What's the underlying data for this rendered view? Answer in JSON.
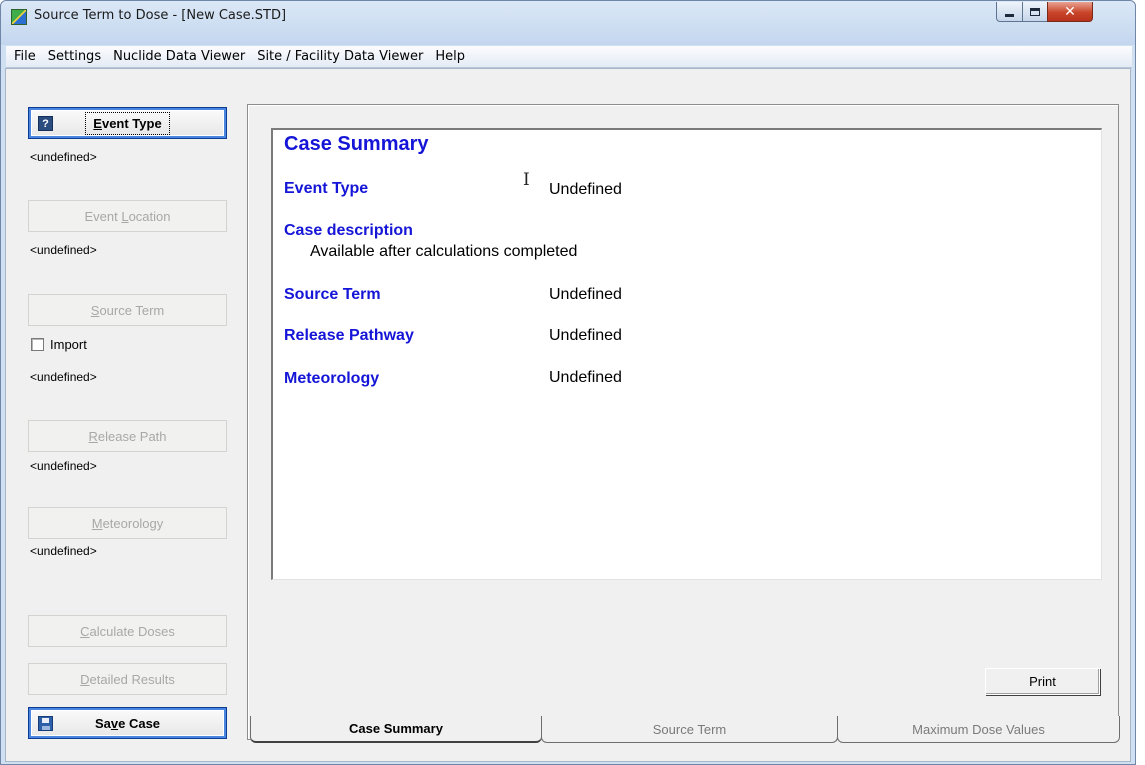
{
  "window": {
    "title": "Source Term to Dose - [New Case.STD]",
    "app_icon": "app-icon",
    "controls": [
      "minimize-icon",
      "maximize-icon",
      "close-icon"
    ]
  },
  "menu": {
    "items": [
      "File",
      "Settings",
      "Nuclide Data Viewer",
      "Site / Facility Data Viewer",
      "Help"
    ]
  },
  "sidebar": {
    "event_type": {
      "label": "Event Type",
      "accel": "E",
      "rest": "vent Type",
      "value": "<undefined>",
      "icon": "help-icon"
    },
    "event_location": {
      "pre": "Event ",
      "accel": "L",
      "rest": "ocation",
      "value": "<undefined>"
    },
    "source_term": {
      "pre": "",
      "accel": "S",
      "rest": "ource Term",
      "import_label": "Import",
      "import_checked": false,
      "value": "<undefined>"
    },
    "release_path": {
      "pre": "",
      "accel": "R",
      "rest": "elease Path",
      "value": "<undefined>"
    },
    "meteorology": {
      "pre": "",
      "accel": "M",
      "rest": "eteorology",
      "value": "<undefined>"
    },
    "calculate_doses": {
      "pre": "",
      "accel": "C",
      "rest": "alculate Doses"
    },
    "detailed_results": {
      "pre": "",
      "accel": "D",
      "rest": "etailed Results"
    },
    "save_case": {
      "pre": "Sa",
      "accel": "v",
      "rest": "e Case",
      "icon": "floppy-disk-icon"
    }
  },
  "summary": {
    "title": "Case Summary",
    "event_type_label": "Event Type",
    "event_type_value": "Undefined",
    "case_description_label": "Case description",
    "case_description_value": "Available after calculations completed",
    "source_term_label": "Source Term",
    "source_term_value": "Undefined",
    "release_pathway_label": "Release Pathway",
    "release_pathway_value": "Undefined",
    "meteorology_label": "Meteorology",
    "meteorology_value": "Undefined",
    "cursor_glyph": "I",
    "print_label": "Print"
  },
  "tabs": [
    {
      "label": "Case Summary",
      "active": true
    },
    {
      "label": "Source Term",
      "active": false
    },
    {
      "label": "Maximum Dose Values",
      "active": false
    }
  ]
}
